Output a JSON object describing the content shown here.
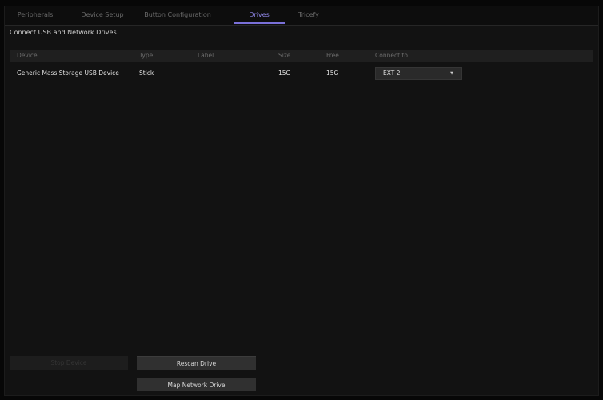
{
  "tabs": [
    {
      "label": "Peripherals",
      "active": false
    },
    {
      "label": "Device Setup",
      "active": false
    },
    {
      "label": "Button Configuration",
      "active": false
    },
    {
      "label": "Drives",
      "active": true
    },
    {
      "label": "Tricefy",
      "active": false
    }
  ],
  "section": {
    "title": "Connect USB and Network Drives"
  },
  "table": {
    "columns": [
      "Device",
      "Type",
      "Label",
      "Size",
      "Free",
      "Connect to"
    ],
    "rows": [
      {
        "device": "Generic Mass Storage USB Device",
        "type": "Stick",
        "label": "",
        "size": "15G",
        "free": "15G",
        "connect_to": "EXT 2"
      }
    ]
  },
  "buttons": {
    "stop_device": "Stop Device",
    "rescan_drive": "Rescan Drive",
    "map_network_drive": "Map Network Drive"
  },
  "colors": {
    "accent": "#7a70d8",
    "background": "#121212",
    "header_bg": "#1f1f1f",
    "button_bg": "#303030"
  }
}
